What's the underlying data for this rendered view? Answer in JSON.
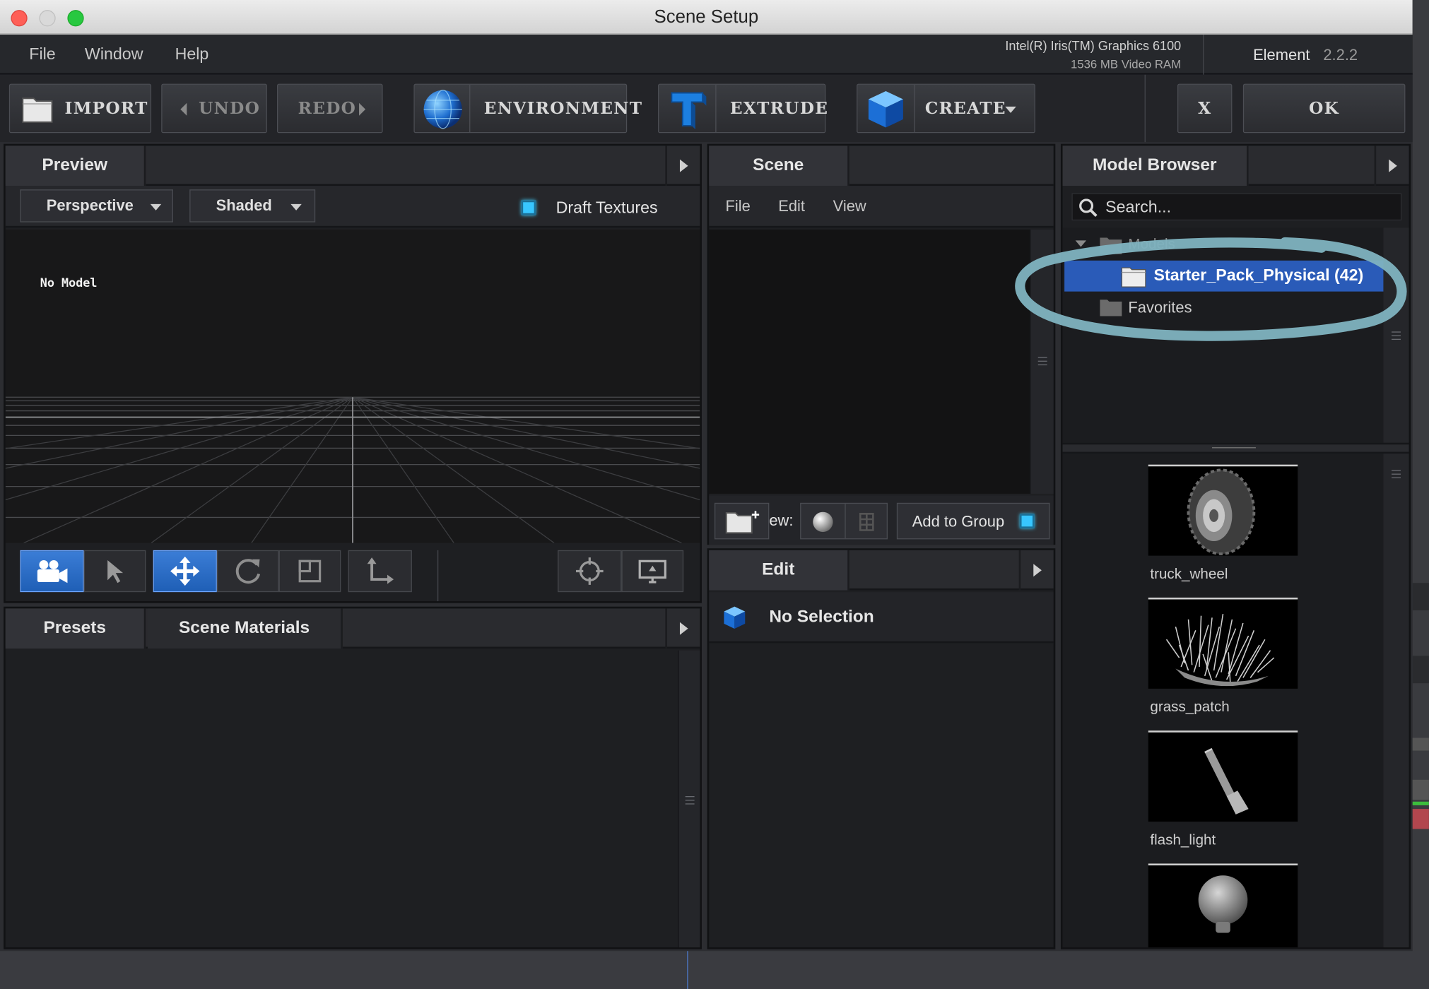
{
  "window": {
    "title": "Scene Setup"
  },
  "menu": {
    "file": "File",
    "window": "Window",
    "help": "Help"
  },
  "gpu": {
    "name": "Intel(R) Iris(TM) Graphics 6100",
    "vram": "1536 MB Video RAM"
  },
  "product": {
    "name": "Element",
    "version": "2.2.2"
  },
  "toolbar": {
    "import": "IMPORT",
    "undo": "UNDO",
    "redo": "REDO",
    "environment": "ENVIRONMENT",
    "extrude": "EXTRUDE",
    "create": "CREATE",
    "close": "X",
    "ok": "OK"
  },
  "preview": {
    "tab": "Preview",
    "camera": "Perspective",
    "shading": "Shaded",
    "draft_textures": "Draft Textures",
    "no_model": "No Model"
  },
  "bottom_panel": {
    "tab_presets": "Presets",
    "tab_materials": "Scene Materials"
  },
  "scene": {
    "tab": "Scene",
    "menu": {
      "file": "File",
      "edit": "Edit",
      "view": "View"
    },
    "view_label": "ew:",
    "add_to_group": "Add to Group"
  },
  "edit": {
    "tab": "Edit",
    "selection": "No Selection"
  },
  "model_browser": {
    "tab": "Model Browser",
    "search_placeholder": "Search...",
    "tree": {
      "models": "Models",
      "starter_pack": "Starter_Pack_Physical (42)",
      "favorites": "Favorites"
    },
    "models": [
      {
        "label": "truck_wheel"
      },
      {
        "label": "grass_patch"
      },
      {
        "label": "flash_light"
      },
      {
        "label": ""
      }
    ]
  },
  "colors": {
    "accent_blue": "#2a5bb8",
    "annotation_circle": "#7fb3c0",
    "checkbox": "#38c6ff"
  }
}
